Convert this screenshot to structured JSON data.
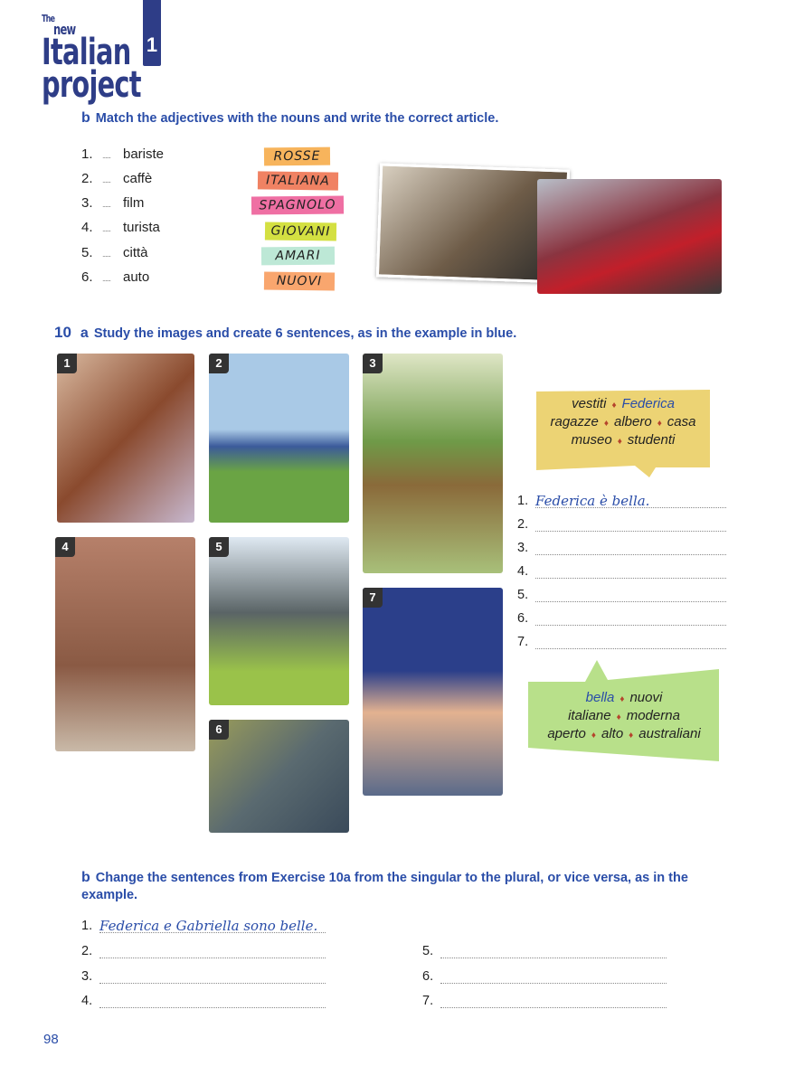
{
  "header": {
    "logo": {
      "line1": "The",
      "line2": "new",
      "line3": "Italian",
      "line4": "project"
    },
    "unit_tab": "1"
  },
  "ex9b": {
    "letter": "b",
    "instruction": "Match the adjectives with the nouns and write the correct article.",
    "items": [
      {
        "n": "1.",
        "noun": "bariste"
      },
      {
        "n": "2.",
        "noun": "caffè"
      },
      {
        "n": "3.",
        "noun": "film"
      },
      {
        "n": "4.",
        "noun": "turista"
      },
      {
        "n": "5.",
        "noun": "città"
      },
      {
        "n": "6.",
        "noun": "auto"
      }
    ],
    "blank": "......",
    "adjectives": [
      {
        "text": "ROSSE",
        "color": "#f7b45c"
      },
      {
        "text": "ITALIANA",
        "color": "#f08263"
      },
      {
        "text": "SPAGNOLO",
        "color": "#ef6fa3"
      },
      {
        "text": "GIOVANI",
        "color": "#d4e042"
      },
      {
        "text": "AMARI",
        "color": "#bde8d6"
      },
      {
        "text": "NUOVI",
        "color": "#f9a66e"
      }
    ]
  },
  "ex10a": {
    "number": "10",
    "letter": "a",
    "instruction": "Study the images and create 6 sentences, as in the example in blue.",
    "images": [
      "1",
      "2",
      "3",
      "4",
      "5",
      "6",
      "7"
    ],
    "nouns": [
      "vestiti",
      "Federica",
      "ragazze",
      "albero",
      "casa",
      "museo",
      "studenti"
    ],
    "adjectives": [
      "bella",
      "nuovi",
      "italiane",
      "moderna",
      "aperto",
      "alto",
      "australiani"
    ],
    "lines": [
      {
        "n": "1.",
        "text": "Federica è bella."
      },
      {
        "n": "2.",
        "text": ""
      },
      {
        "n": "3.",
        "text": ""
      },
      {
        "n": "4.",
        "text": ""
      },
      {
        "n": "5.",
        "text": ""
      },
      {
        "n": "6.",
        "text": ""
      },
      {
        "n": "7.",
        "text": ""
      }
    ],
    "colors": {
      "noun_bubble": "#ecd374",
      "adj_bubble": "#b8e08a"
    }
  },
  "ex10b": {
    "letter": "b",
    "instruction": "Change the sentences from Exercise 10a from the singular to the plural, or vice versa, as in the example.",
    "lines": [
      {
        "n": "1.",
        "text": "Federica e Gabriella sono belle."
      },
      {
        "n": "2.",
        "text": ""
      },
      {
        "n": "3.",
        "text": ""
      },
      {
        "n": "4.",
        "text": ""
      },
      {
        "n": "5.",
        "text": ""
      },
      {
        "n": "6.",
        "text": ""
      },
      {
        "n": "7.",
        "text": ""
      }
    ]
  },
  "footer": {
    "page_number": "98"
  }
}
